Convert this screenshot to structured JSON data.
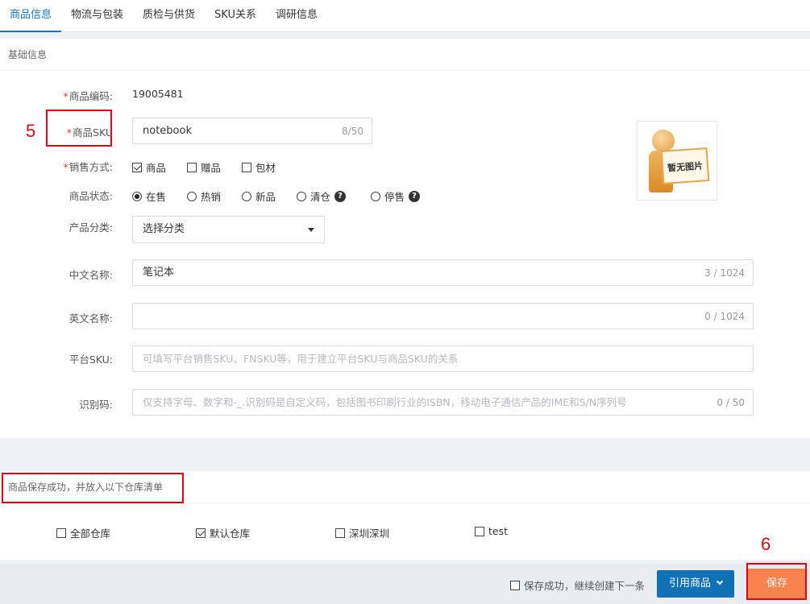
{
  "tabs": [
    "商品信息",
    "物流与包装",
    "质检与供货",
    "SKU关系",
    "调研信息"
  ],
  "basic": {
    "section_title": "基础信息",
    "product_code": {
      "label": "商品编码:",
      "value": "19005481"
    },
    "sku": {
      "label": "商品SKU",
      "value": "notebook",
      "count": "8/50"
    },
    "sale_mode": {
      "label": "销售方式:",
      "options": [
        {
          "text": "商品",
          "checked": true
        },
        {
          "text": "赠品",
          "checked": false
        },
        {
          "text": "包材",
          "checked": false
        }
      ]
    },
    "status": {
      "label": "商品状态:",
      "options": [
        {
          "text": "在售",
          "selected": true
        },
        {
          "text": "热销",
          "selected": false
        },
        {
          "text": "新品",
          "selected": false
        },
        {
          "text": "清仓",
          "selected": false
        },
        {
          "text": "停售",
          "selected": false
        }
      ]
    },
    "category": {
      "label": "产品分类:",
      "value": "选择分类"
    },
    "cn_name": {
      "label": "中文名称:",
      "value": "笔记本",
      "count": "3 / 1024"
    },
    "en_name": {
      "label": "英文名称:",
      "value": "",
      "count": "0 / 1024"
    },
    "platform_sku": {
      "label": "平台SKU:",
      "placeholder": "可填写平台销售SKU、FNSKU等，用于建立平台SKU与商品SKU的关系"
    },
    "ident_code": {
      "label": "识别码:",
      "placeholder": "仅支持字母、数字和-_.识别码是自定义码，包括图书印刷行业的ISBN，移动电子通信产品的IME和S/N序列号",
      "count": "0 / 50"
    },
    "no_image": "暂无图片"
  },
  "warehouse": {
    "title": "商品保存成功，并放入以下仓库清单",
    "options": [
      {
        "text": "全部仓库",
        "checked": false
      },
      {
        "text": "默认仓库",
        "checked": true
      },
      {
        "text": "深圳深圳",
        "checked": false
      },
      {
        "text": "test",
        "checked": false
      }
    ]
  },
  "footer": {
    "continue_label": "保存成功，继续创建下一条",
    "ref_button": "引用商品",
    "save_button": "保存"
  },
  "annotations": {
    "n5": "5",
    "n6": "6"
  },
  "colors": {
    "accent": "#1479c1",
    "required": "#e4393c",
    "save": "#f9824d",
    "ref": "#1171b5",
    "annotation": "#e60012"
  }
}
